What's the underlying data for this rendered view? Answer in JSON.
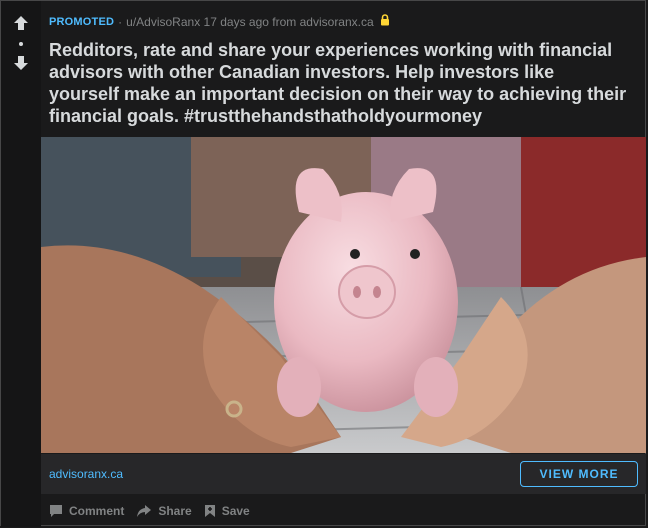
{
  "post": {
    "promoted_label": "PROMOTED",
    "separator": "·",
    "author": "u/AdvisoRanx",
    "time": "17 days ago",
    "source_prefix": "from",
    "source": "advisoranx.ca",
    "title": "Redditors, rate and share your experiences working with financial advisors with other Canadian investors. Help investors like yourself make an important decision on their way to achieving their financial goals. #trustthehandsthatholdyourmoney"
  },
  "media": {
    "icon": "piggy-bank-photo",
    "description_hidden": false
  },
  "link_bar": {
    "domain": "advisoranx.ca",
    "cta_label": "VIEW MORE"
  },
  "actions": {
    "comment_label": "Comment",
    "share_label": "Share",
    "save_label": "Save"
  },
  "icons": {
    "upvote": "arrow-up-icon",
    "downvote": "arrow-down-icon",
    "lock": "lock-icon",
    "comment": "comment-icon",
    "share": "share-icon",
    "save": "bookmark-icon"
  },
  "colors": {
    "background": "#1a1a1b",
    "accent": "#4fbcff",
    "lock": "#ffd635",
    "text": "#d7dadc",
    "muted": "#818384"
  }
}
